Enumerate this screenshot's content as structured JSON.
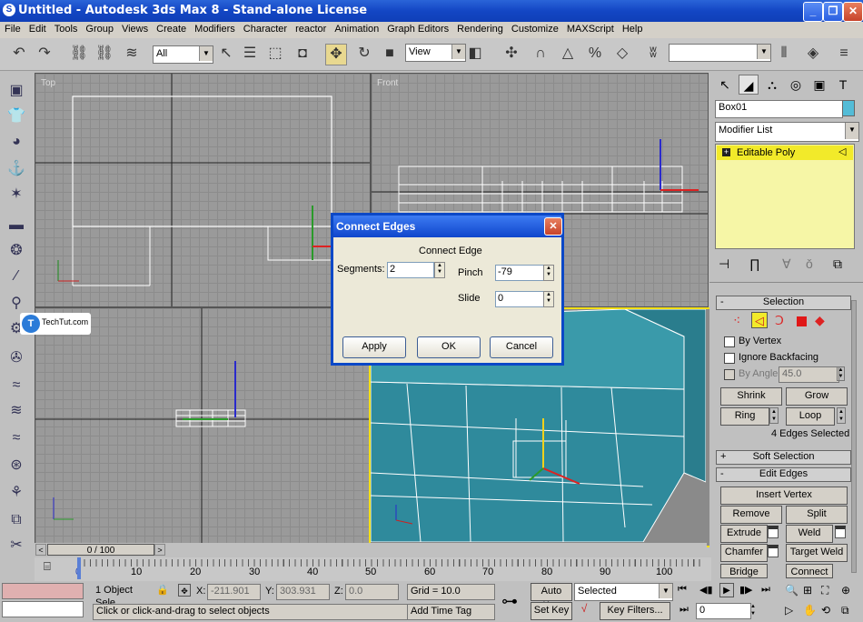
{
  "window": {
    "title": "Untitled - Autodesk 3ds Max 8  - Stand-alone License"
  },
  "menu": [
    "File",
    "Edit",
    "Tools",
    "Group",
    "Views",
    "Create",
    "Modifiers",
    "Character",
    "reactor",
    "Animation",
    "Graph Editors",
    "Rendering",
    "Customize",
    "MAXScript",
    "Help"
  ],
  "toolbar": {
    "selection_filter": "All",
    "ref_coord": "View"
  },
  "viewports": {
    "top": "Top",
    "front": "Front"
  },
  "watermark": "TechTut.com",
  "dialog": {
    "title": "Connect Edges",
    "group": "Connect Edge",
    "segments_label": "Segments:",
    "segments_value": "2",
    "pinch_label": "Pinch",
    "pinch_value": "-79",
    "slide_label": "Slide",
    "slide_value": "0",
    "apply": "Apply",
    "ok": "OK",
    "cancel": "Cancel"
  },
  "command_panel": {
    "object_name": "Box01",
    "modifier_list": "Modifier List",
    "stack_item": "Editable Poly",
    "selection_rollout": "Selection",
    "by_vertex": "By Vertex",
    "ignore_backfacing": "Ignore Backfacing",
    "by_angle": "By Angle:",
    "angle_value": "45.0",
    "shrink": "Shrink",
    "grow": "Grow",
    "ring": "Ring",
    "loop": "Loop",
    "selected_status": "4 Edges Selected",
    "soft_selection": "Soft Selection",
    "edit_edges": "Edit Edges",
    "insert_vertex": "Insert Vertex",
    "remove": "Remove",
    "split": "Split",
    "extrude": "Extrude",
    "weld": "Weld",
    "chamfer": "Chamfer",
    "target_weld": "Target Weld",
    "bridge": "Bridge",
    "connect": "Connect"
  },
  "timeline": {
    "frame": "0 / 100",
    "ticks": [
      "0",
      "10",
      "20",
      "30",
      "40",
      "50",
      "60",
      "70",
      "80",
      "90",
      "100"
    ]
  },
  "status": {
    "objects": "1 Object Sele",
    "x_label": "X:",
    "x_value": "-211.901",
    "y_label": "Y:",
    "y_value": "303.931",
    "z_label": "Z:",
    "z_value": "0.0",
    "grid": "Grid = 10.0",
    "prompt": "Click or click-and-drag to select objects",
    "add_time_tag": "Add Time Tag",
    "auto_key": "Auto Key",
    "selected": "Selected",
    "set_key": "Set Key",
    "key_filters": "Key Filters...",
    "current_frame": "0"
  }
}
